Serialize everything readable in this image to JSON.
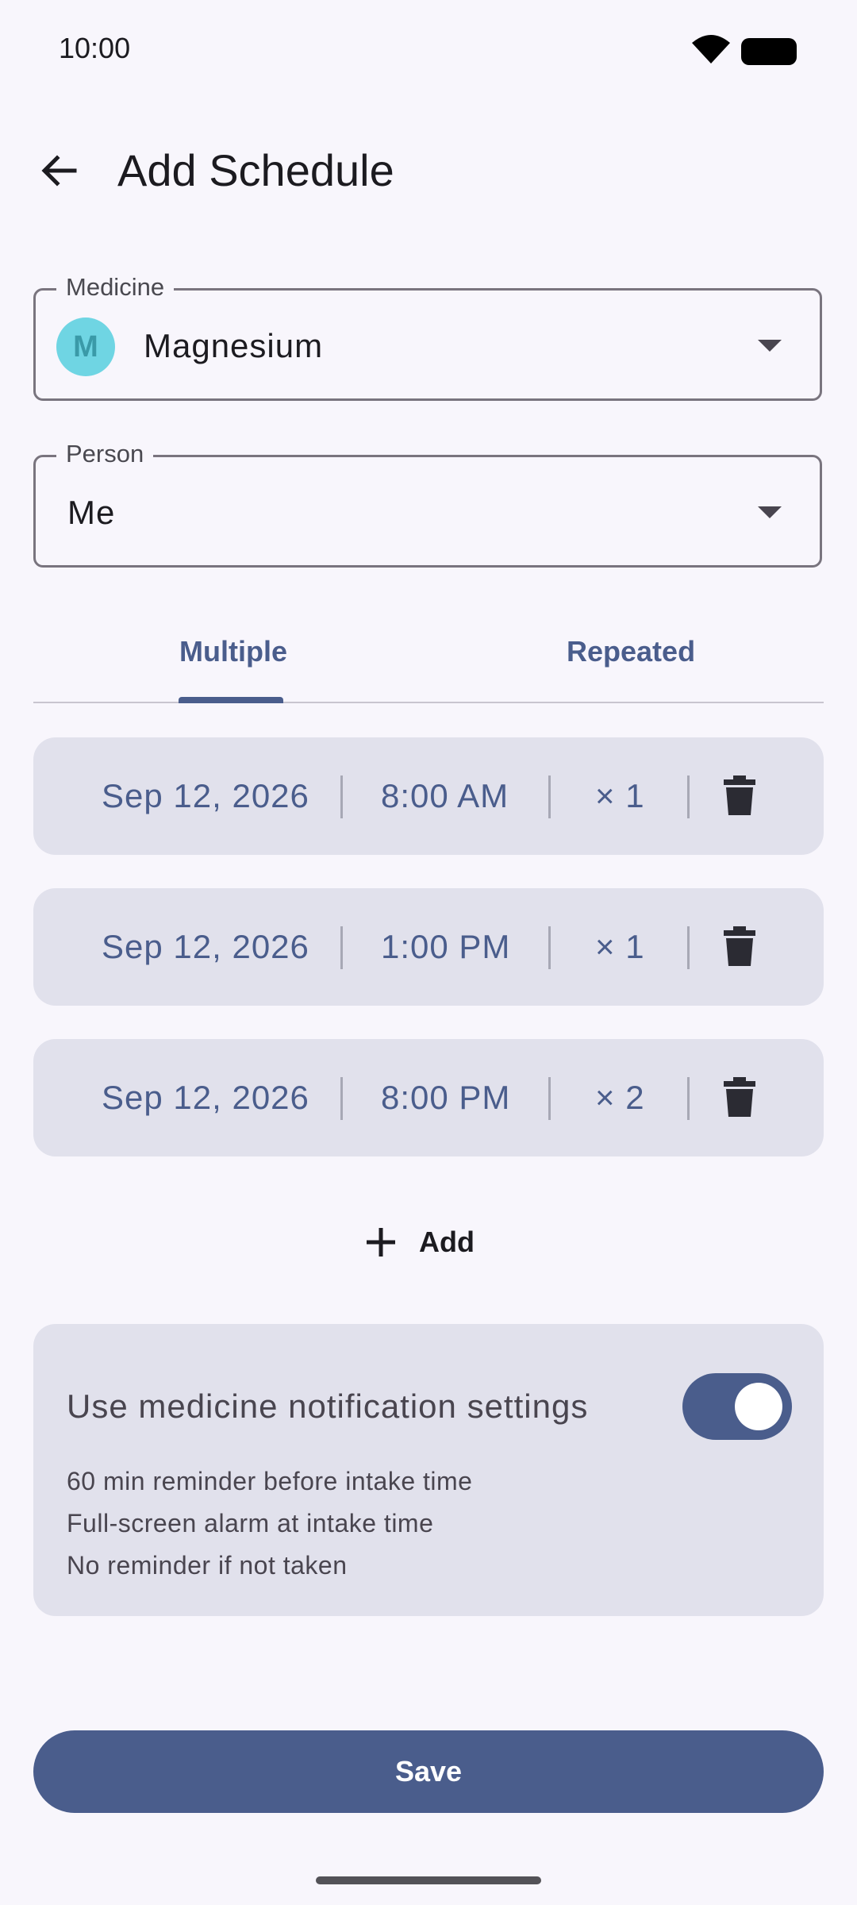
{
  "status_bar": {
    "time": "10:00",
    "icons": [
      "wifi-icon",
      "battery-icon"
    ]
  },
  "app_bar": {
    "title": "Add Schedule",
    "back_icon": "arrow-back-icon"
  },
  "medicine_field": {
    "label": "Medicine",
    "avatar_letter": "M",
    "value": "Magnesium",
    "avatar_color": "#6fd5e3"
  },
  "person_field": {
    "label": "Person",
    "value": "Me"
  },
  "tabs": [
    {
      "label": "Multiple",
      "selected": true
    },
    {
      "label": "Repeated",
      "selected": false
    }
  ],
  "schedules": [
    {
      "date": "Sep 12, 2026",
      "time": "8:00 AM",
      "dose": "× 1"
    },
    {
      "date": "Sep 12, 2026",
      "time": "1:00 PM",
      "dose": "× 1"
    },
    {
      "date": "Sep 12, 2026",
      "time": "8:00 PM",
      "dose": "× 2"
    }
  ],
  "add_button": {
    "label": "Add"
  },
  "notification": {
    "title": "Use medicine notification settings",
    "toggle_on": true,
    "lines": [
      "60 min reminder before intake time",
      "Full-screen alarm at intake time",
      "No reminder if not taken"
    ]
  },
  "save_button": {
    "label": "Save"
  },
  "colors": {
    "primary": "#4a5d8c",
    "surface": "#f8f6fc",
    "container": "#e1e1ec"
  }
}
